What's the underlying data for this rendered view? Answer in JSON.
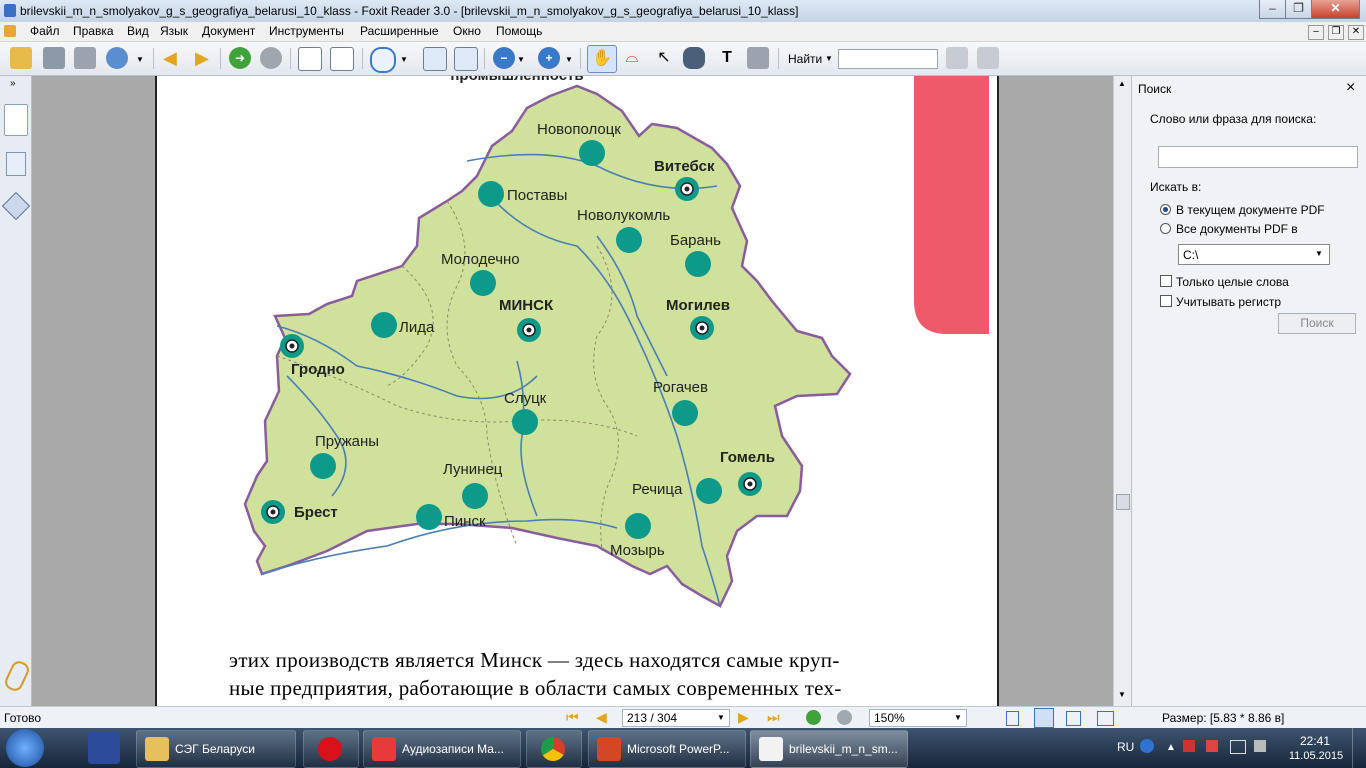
{
  "window": {
    "title": "brilevskii_m_n_smolyakov_g_s_geografiya_belarusi_10_klass - Foxit Reader 3.0 - [brilevskii_m_n_smolyakov_g_s_geografiya_belarusi_10_klass]",
    "minimize": "–",
    "restore": "❐",
    "close": "✕"
  },
  "menu": [
    "Файл",
    "Правка",
    "Вид",
    "Язык",
    "Документ",
    "Инструменты",
    "Расширенные",
    "Окно",
    "Помощь"
  ],
  "toolbar": {
    "find_label": "Найти",
    "find_value": ""
  },
  "page": {
    "top_clip": "промышленность",
    "paragraph_line1": "этих производств является Минск — здесь находятся самые круп-",
    "paragraph_line2": "ные предприятия, работающие в области самых современных тех-"
  },
  "map": {
    "cities": [
      {
        "name": "Новополоцк",
        "bold": false
      },
      {
        "name": "Витебск",
        "bold": true
      },
      {
        "name": "Поставы",
        "bold": false
      },
      {
        "name": "Новолукомль",
        "bold": false
      },
      {
        "name": "Барань",
        "bold": false
      },
      {
        "name": "Молодечно",
        "bold": false
      },
      {
        "name": "МИНСК",
        "bold": true
      },
      {
        "name": "Могилев",
        "bold": true
      },
      {
        "name": "Лида",
        "bold": false
      },
      {
        "name": "Гродно",
        "bold": true
      },
      {
        "name": "Рогачев",
        "bold": false
      },
      {
        "name": "Слуцк",
        "bold": false
      },
      {
        "name": "Пружаны",
        "bold": false
      },
      {
        "name": "Гомель",
        "bold": true
      },
      {
        "name": "Лунинец",
        "bold": false
      },
      {
        "name": "Речица",
        "bold": false
      },
      {
        "name": "Брест",
        "bold": true
      },
      {
        "name": "Пинск",
        "bold": false
      },
      {
        "name": "Мозырь",
        "bold": false
      }
    ],
    "colors": {
      "land": "#cfe19a",
      "border": "#8a5c9e",
      "marker": "#0e9a8a",
      "river": "#4a7fb5",
      "accent_tab": "#ef5a6a"
    }
  },
  "search": {
    "title": "Поиск",
    "close": "×",
    "prompt": "Слово или фраза для поиска:",
    "query": "",
    "look_in": "Искать в:",
    "option_current": "В текущем документе PDF",
    "option_all": "Все документы PDF в",
    "folder": "C:\\",
    "whole_words": "Только целые слова",
    "match_case": "Учитывать регистр",
    "button": "Поиск"
  },
  "status": {
    "ready": "Готово",
    "page_field": "213 / 304",
    "zoom": "150%",
    "size": "Размер: [5.83 * 8.86 в]"
  },
  "taskbar": {
    "items": [
      "СЭГ Беларуси",
      "Аудиозаписи Ма...",
      "Microsoft PowerP...",
      "brilevskii_m_n_sm..."
    ],
    "lang": "RU",
    "time": "22:41",
    "date": "11.05.2015"
  }
}
